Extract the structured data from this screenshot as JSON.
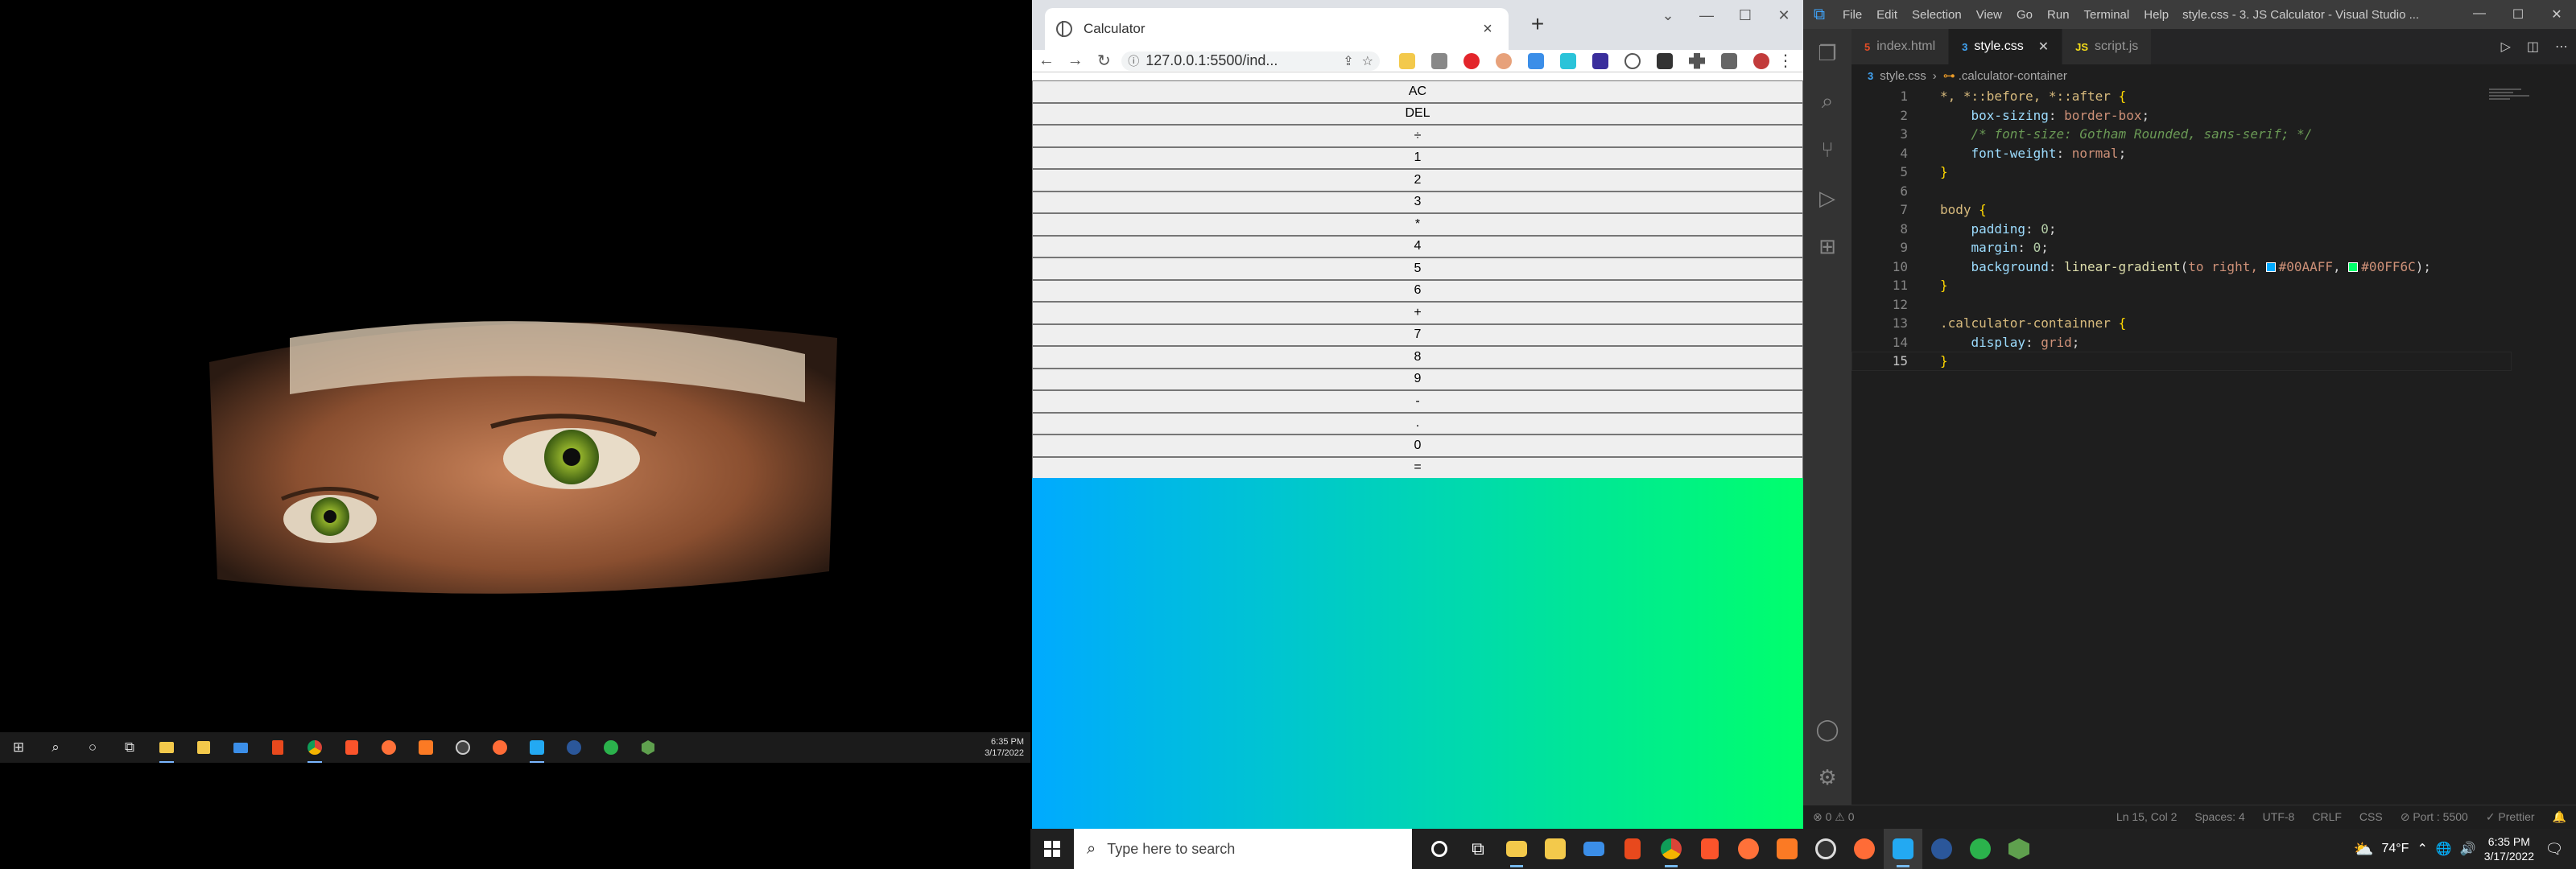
{
  "left_taskbar": {
    "clock_time": "6:35 PM",
    "clock_date": "3/17/2022"
  },
  "browser": {
    "tab_title": "Calculator",
    "tab_close": "×",
    "new_tab": "+",
    "url": "127.0.0.1:5500/ind...",
    "calculator_buttons": [
      "AC",
      "DEL",
      "÷",
      "1",
      "2",
      "3",
      "*",
      "4",
      "5",
      "6",
      "+",
      "7",
      "8",
      "9",
      "-",
      ".",
      "0",
      "="
    ],
    "page_gradient": {
      "from": "#00AAFF",
      "to": "#00FF6C"
    }
  },
  "vscode": {
    "menu": [
      "File",
      "Edit",
      "Selection",
      "View",
      "Go",
      "Run",
      "Terminal",
      "Help"
    ],
    "window_title": "style.css - 3. JS Calculator - Visual Studio ...",
    "tabs": [
      {
        "icon": "5",
        "label": "index.html",
        "active": false
      },
      {
        "icon": "3",
        "label": "style.css",
        "active": true
      },
      {
        "icon": "JS",
        "label": "script.js",
        "active": false
      }
    ],
    "breadcrumb": [
      "style.css",
      ".calculator-container"
    ],
    "line_numbers": [
      "1",
      "2",
      "3",
      "4",
      "5",
      "6",
      "7",
      "8",
      "9",
      "10",
      "11",
      "12",
      "13",
      "14",
      "15"
    ],
    "code": {
      "l1_selector": "*, *::before, *::after",
      "l2_prop": "box-sizing",
      "l2_val": "border-box",
      "l3_comment": "/* font-size: Gotham Rounded, sans-serif; */",
      "l4_prop": "font-weight",
      "l4_val": "normal",
      "l7_selector": "body",
      "l8_prop": "padding",
      "l8_val": "0",
      "l9_prop": "margin",
      "l9_val": "0",
      "l10_prop": "background",
      "l10_fn": "linear-gradient",
      "l10_args": "to right, ",
      "l10_color1": "#00AAFF",
      "l10_color2": "#00FF6C",
      "l13_selector": ".calculator-containner",
      "l14_prop": "display",
      "l14_val": "grid"
    },
    "status": {
      "errors": "⊗ 0 ⚠ 0",
      "position": "Ln 15, Col 2",
      "spaces": "Spaces: 4",
      "encoding": "UTF-8",
      "eol": "CRLF",
      "language": "CSS",
      "port": "⊘ Port : 5500",
      "prettier": "✓ Prettier"
    }
  },
  "taskbar": {
    "search_placeholder": "Type here to search",
    "weather": "74°F",
    "clock_time": "6:35 PM",
    "clock_date": "3/17/2022"
  }
}
